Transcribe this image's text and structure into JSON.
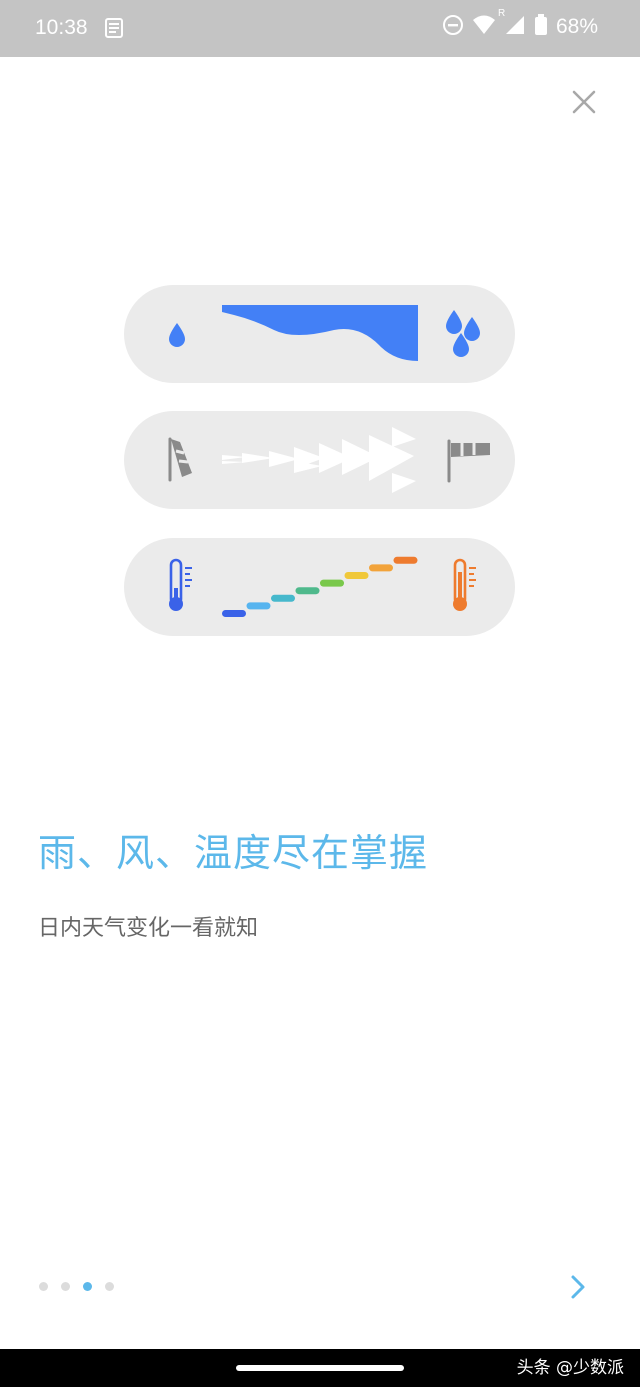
{
  "status_bar": {
    "time": "10:38",
    "network_label": "R",
    "battery": "68%",
    "icons": [
      "notes-notification-icon",
      "do-not-disturb-icon",
      "wifi-icon",
      "cellular-signal-icon",
      "battery-icon"
    ]
  },
  "close": {
    "icon": "close-icon"
  },
  "features": [
    {
      "name": "rain",
      "left_icon": "single-raindrop-icon",
      "right_icon": "three-raindrops-icon",
      "graphic": "rain-intensity-wave",
      "color": "#4380f6"
    },
    {
      "name": "wind",
      "left_icon": "windsock-calm-icon",
      "right_icon": "windsock-strong-icon",
      "graphic": "wind-arrow-cones",
      "color": "#8a8a8a"
    },
    {
      "name": "temperature",
      "left_icon": "cold-thermometer-icon",
      "right_icon": "hot-thermometer-icon",
      "graphic": "temperature-steps",
      "color": "#f07b2c"
    }
  ],
  "temperature_step_colors": [
    "#3a62e8",
    "#56b4ef",
    "#46b8cc",
    "#4fb98c",
    "#79c84b",
    "#f0c83a",
    "#f2a33a",
    "#ee7b2e"
  ],
  "headline": "雨、风、温度尽在掌握",
  "subtitle": "日内天气变化一看就知",
  "pager": {
    "total": 4,
    "active_index": 2
  },
  "next": {
    "icon": "chevron-right-icon"
  },
  "watermark": "头条 @少数派",
  "colors": {
    "accent": "#5cb8ea",
    "pill_bg": "#ebebeb",
    "status_bar": "#c4c4c4"
  }
}
